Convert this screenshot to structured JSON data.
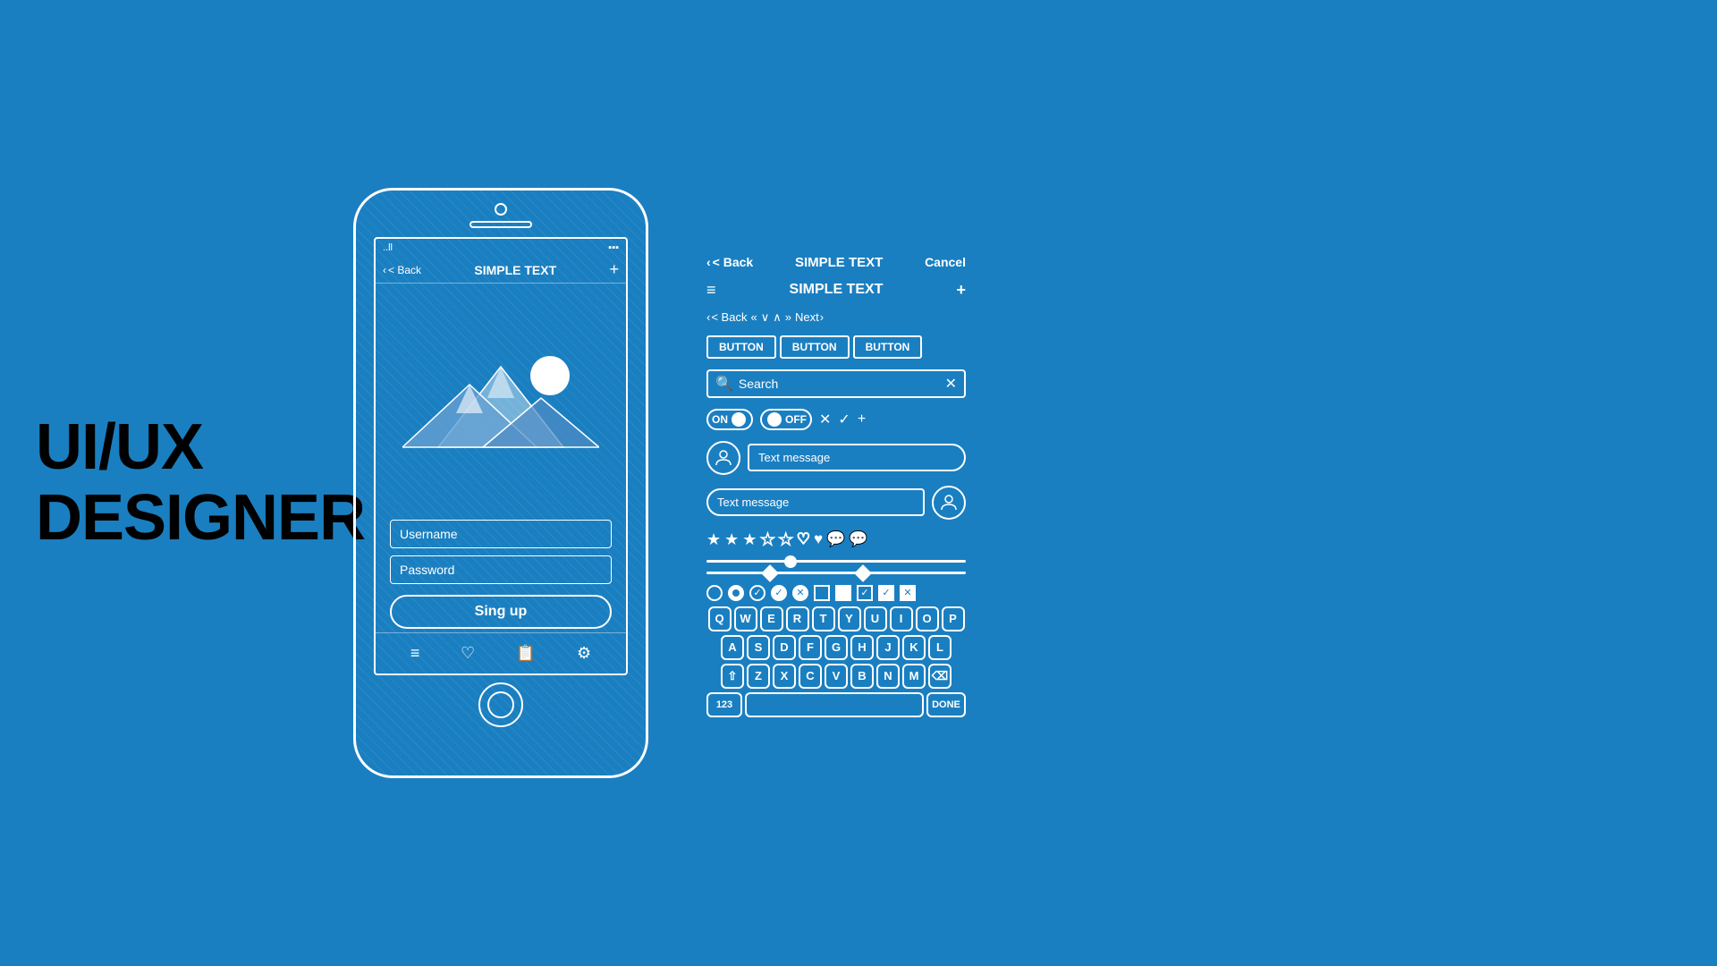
{
  "title": {
    "line1": "UI/UX",
    "line2": "DESIGNER"
  },
  "phone": {
    "status_signal": "..ll",
    "status_battery": "▪▪▪",
    "nav_back": "< Back",
    "nav_title": "SIMPLE TEXT",
    "nav_plus": "+",
    "username_placeholder": "Username",
    "password_placeholder": "Password",
    "signup_label": "Sing up",
    "bottom_icons": [
      "≡",
      "♡",
      "📋",
      "⚙"
    ]
  },
  "panel": {
    "top_back": "< Back",
    "top_title": "SIMPLE TEXT",
    "top_cancel": "Cancel",
    "menu_icon": "≡",
    "menu_title": "SIMPLE TEXT",
    "menu_plus": "+",
    "nav_back": "< Back",
    "nav_prev": "«",
    "nav_down": "∨",
    "nav_up": "∧",
    "nav_next_arrows": "»",
    "nav_next": "Next",
    "nav_next_arrow": ">",
    "btn1": "BUTTON",
    "btn2": "BUTTON",
    "btn3": "BUTTON",
    "search_placeholder": "Search",
    "toggle_on": "ON",
    "toggle_off": "OFF",
    "chat_right": "Text message",
    "chat_left": "Text message",
    "keyboard_row1": [
      "Q",
      "W",
      "E",
      "R",
      "T",
      "Y",
      "U",
      "I",
      "O",
      "P"
    ],
    "keyboard_row2": [
      "A",
      "S",
      "D",
      "F",
      "G",
      "H",
      "J",
      "K",
      "L"
    ],
    "keyboard_row3": [
      "⇧",
      "Z",
      "X",
      "C",
      "V",
      "B",
      "N",
      "M",
      "⌫"
    ],
    "keyboard_bottom_left": "123",
    "keyboard_bottom_right": "DONE"
  },
  "colors": {
    "bg": "#1a7fc1",
    "text_primary": "#ffffff",
    "title_color": "#000000"
  }
}
